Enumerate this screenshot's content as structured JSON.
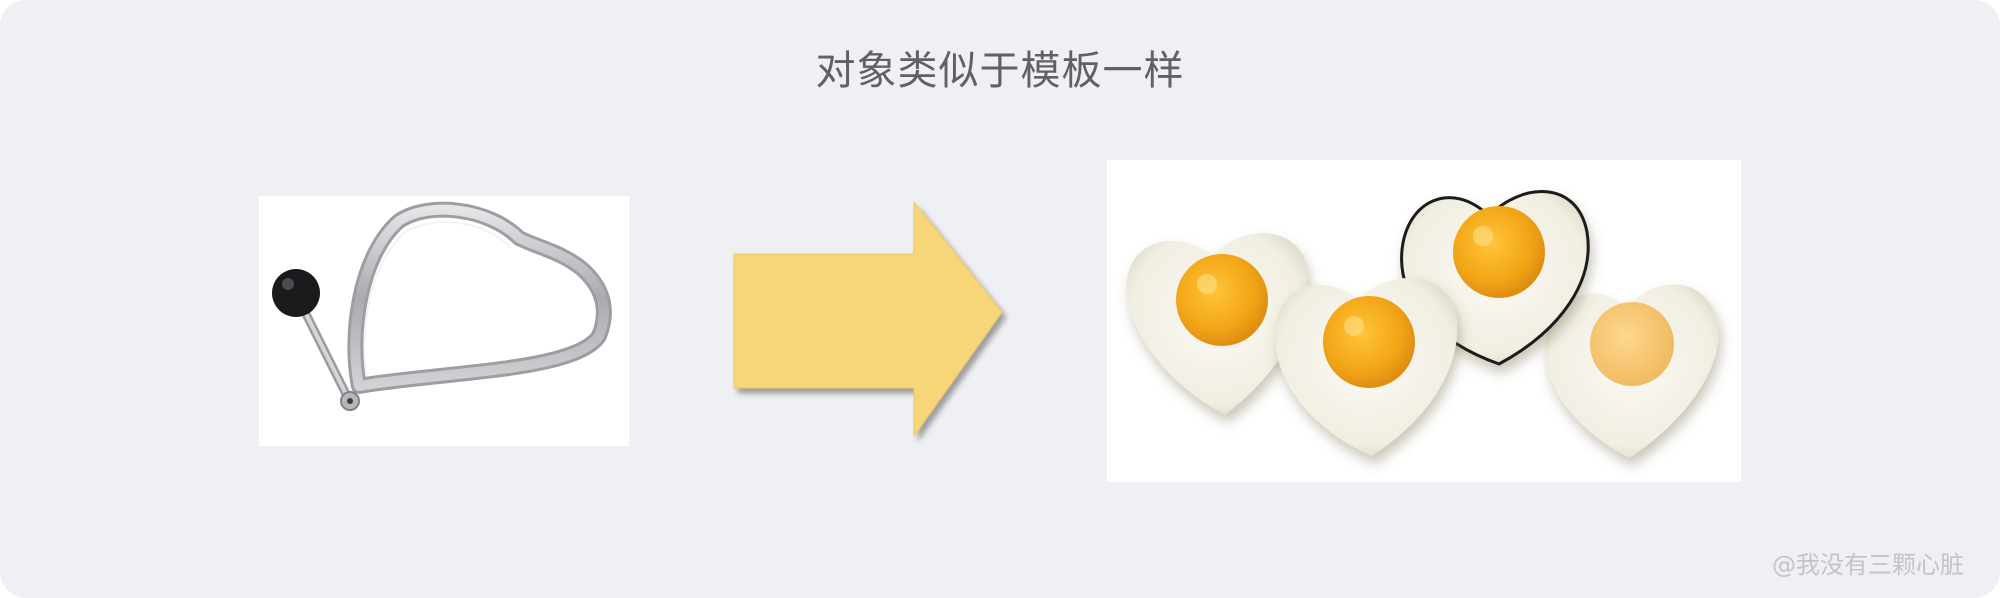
{
  "title": "对象类似于模板一样",
  "watermark": "@我没有三颗心脏",
  "colors": {
    "background": "#eef0f3",
    "arrow_fill": "#f7d67a",
    "title_text": "#5f6165",
    "watermark_text": "#c2c4c8",
    "egg_white": "#f6f3e9",
    "egg_yolk": "#f2a516"
  },
  "icons": {
    "mold": "heart-egg-mold-icon",
    "arrow": "right-arrow-icon",
    "eggs": "heart-fried-eggs-icon"
  }
}
